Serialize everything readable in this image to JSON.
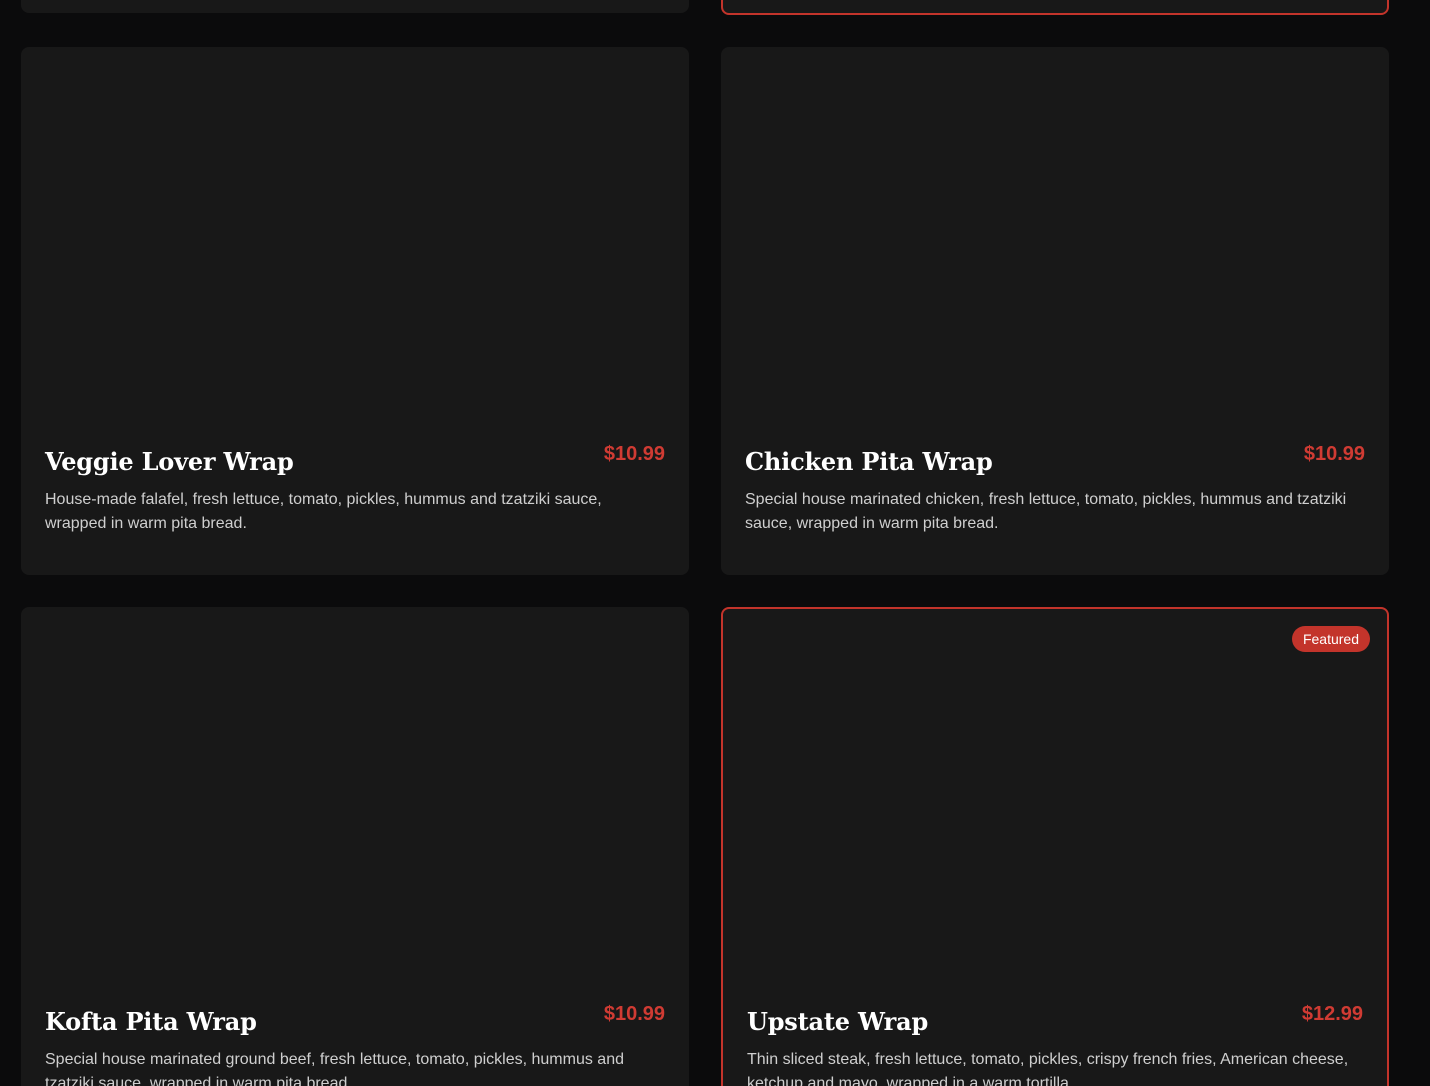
{
  "colors": {
    "background": "#0b0b0c",
    "card": "#181818",
    "accent": "#c3342b",
    "price": "#d03b33"
  },
  "items": [
    {
      "title": "Veggie Lover Wrap",
      "price": "$10.99",
      "description": "House-made falafel, fresh lettuce, tomato, pickles, hummus and tzatziki sauce, wrapped in warm pita bread."
    },
    {
      "title": "Chicken Pita Wrap",
      "price": "$10.99",
      "description": "Special house marinated chicken, fresh lettuce, tomato, pickles, hummus and tzatziki sauce, wrapped in warm pita bread."
    },
    {
      "title": "Kofta Pita Wrap",
      "price": "$10.99",
      "description": "Special house marinated ground beef, fresh lettuce, tomato, pickles, hummus and tzatziki sauce, wrapped in warm pita bread."
    },
    {
      "title": "Upstate Wrap",
      "price": "$12.99",
      "description": "Thin sliced steak, fresh lettuce, tomato, pickles, crispy french fries, American cheese, ketchup and mayo, wrapped in a warm tortilla.",
      "badge": "Featured"
    }
  ]
}
